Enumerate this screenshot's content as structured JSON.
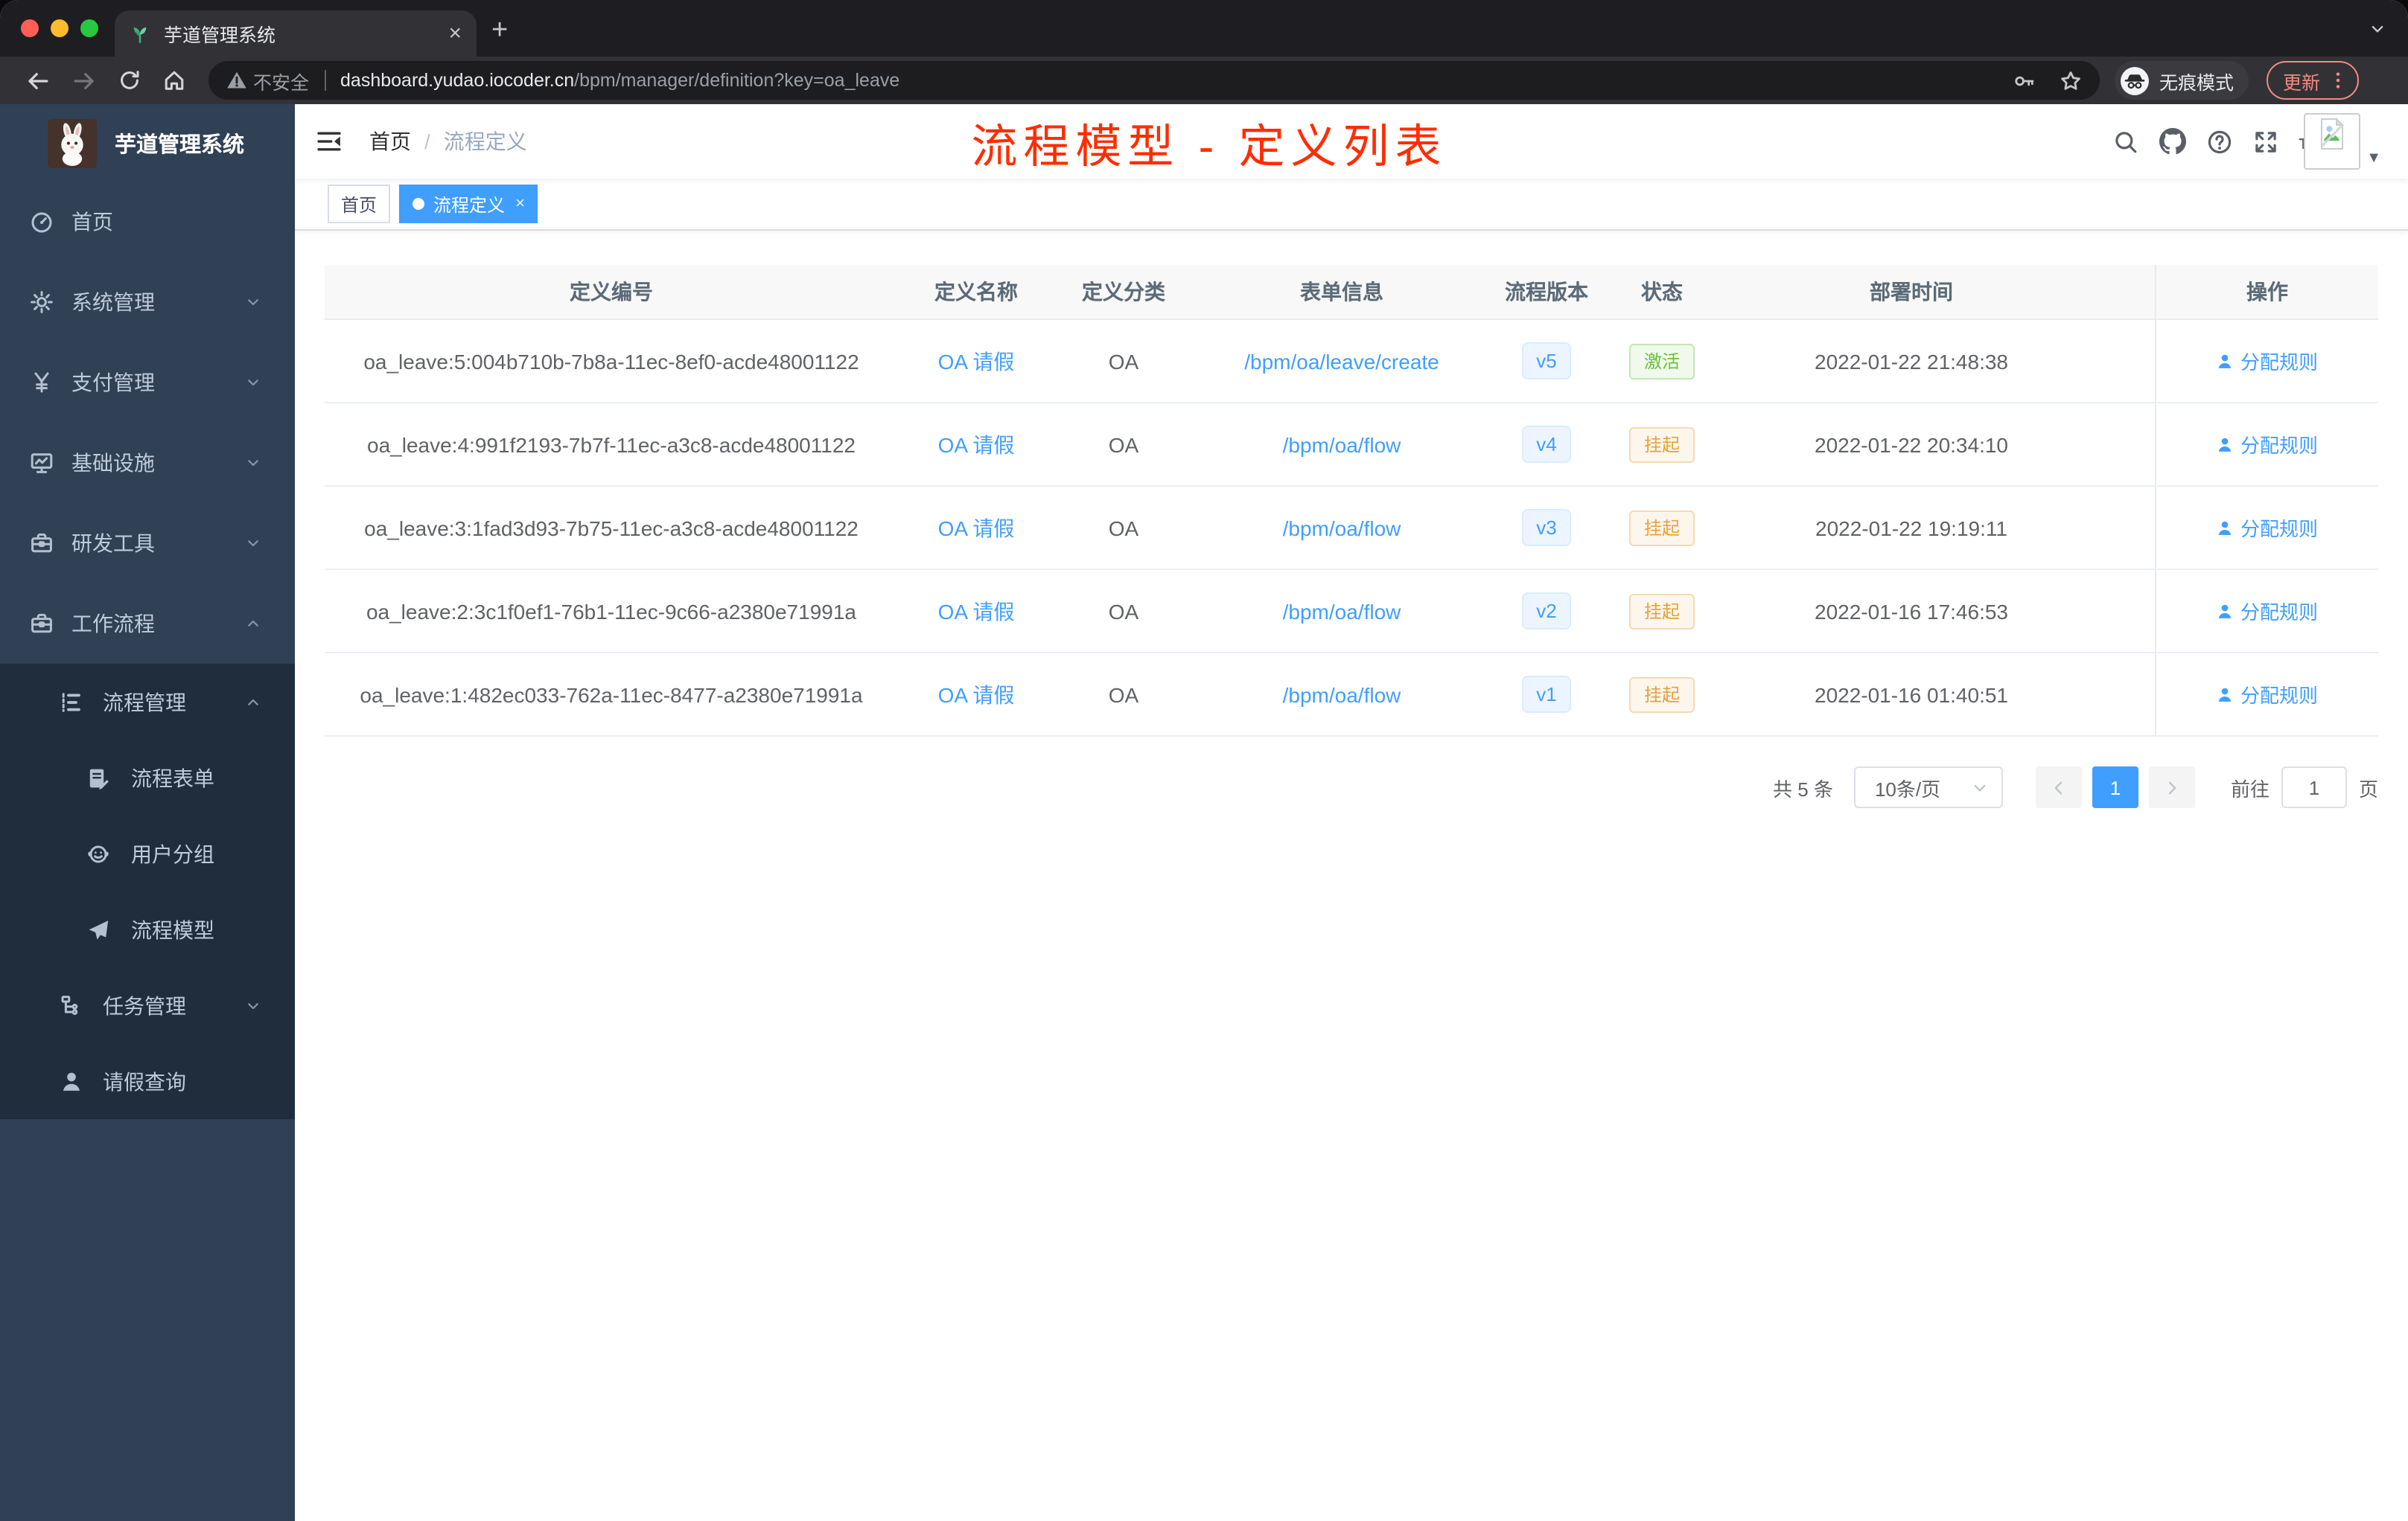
{
  "colors": {
    "accent": "#409eff",
    "success": "#67c23a",
    "warning": "#e6a23c",
    "annotation_red": "#ff2d00",
    "sidebar_bg": "#304156",
    "sidebar_submenu_bg": "#1f2d3d"
  },
  "browser": {
    "tab_title": "芋道管理系统",
    "new_tab_label": "+",
    "tab_close_label": "×",
    "security_label": "不安全",
    "url_host": "dashboard.yudao.iocoder.cn",
    "url_path": "/bpm/manager/definition?key=oa_leave",
    "incognito_label": "无痕模式",
    "update_label": "更新"
  },
  "sidebar": {
    "logo_title": "芋道管理系统",
    "menu": [
      {
        "label": "首页",
        "icon": "dashboard",
        "level": 1,
        "arrow": "",
        "dark": false
      },
      {
        "label": "系统管理",
        "icon": "gear",
        "level": 1,
        "arrow": "down",
        "dark": false
      },
      {
        "label": "支付管理",
        "icon": "yen",
        "level": 1,
        "arrow": "down",
        "dark": false
      },
      {
        "label": "基础设施",
        "icon": "monitor",
        "level": 1,
        "arrow": "down",
        "dark": false
      },
      {
        "label": "研发工具",
        "icon": "toolbox",
        "level": 1,
        "arrow": "down",
        "dark": false
      },
      {
        "label": "工作流程",
        "icon": "briefcase",
        "level": 1,
        "arrow": "up",
        "dark": false
      },
      {
        "label": "流程管理",
        "icon": "tree",
        "level": 2,
        "arrow": "up",
        "dark": true
      },
      {
        "label": "流程表单",
        "icon": "form",
        "level": 3,
        "arrow": "",
        "dark": true
      },
      {
        "label": "用户分组",
        "icon": "people",
        "level": 3,
        "arrow": "",
        "dark": true
      },
      {
        "label": "流程模型",
        "icon": "send",
        "level": 3,
        "arrow": "",
        "dark": true
      },
      {
        "label": "任务管理",
        "icon": "hierarchy",
        "level": 2,
        "arrow": "down",
        "dark": true
      },
      {
        "label": "请假查询",
        "icon": "user",
        "level": 2,
        "arrow": "",
        "dark": true
      }
    ]
  },
  "navbar": {
    "breadcrumb_home": "首页",
    "breadcrumb_sep": "/",
    "breadcrumb_current": "流程定义",
    "annotation": "流程模型 - 定义列表"
  },
  "tags": [
    {
      "label": "首页",
      "active": false,
      "closable": false
    },
    {
      "label": "流程定义",
      "active": true,
      "closable": true,
      "close_label": "×"
    }
  ],
  "table": {
    "columns": [
      "定义编号",
      "定义名称",
      "定义分类",
      "表单信息",
      "流程版本",
      "状态",
      "部署时间",
      "操作"
    ],
    "rows": [
      {
        "id": "oa_leave:5:004b710b-7b8a-11ec-8ef0-acde48001122",
        "name": "OA 请假",
        "category": "OA",
        "form": "/bpm/oa/leave/create",
        "version": "v5",
        "status": "激活",
        "status_type": "active",
        "deploy_time": "2022-01-22 21:48:38",
        "action": "分配规则"
      },
      {
        "id": "oa_leave:4:991f2193-7b7f-11ec-a3c8-acde48001122",
        "name": "OA 请假",
        "category": "OA",
        "form": "/bpm/oa/flow",
        "version": "v4",
        "status": "挂起",
        "status_type": "suspended",
        "deploy_time": "2022-01-22 20:34:10",
        "action": "分配规则"
      },
      {
        "id": "oa_leave:3:1fad3d93-7b75-11ec-a3c8-acde48001122",
        "name": "OA 请假",
        "category": "OA",
        "form": "/bpm/oa/flow",
        "version": "v3",
        "status": "挂起",
        "status_type": "suspended",
        "deploy_time": "2022-01-22 19:19:11",
        "action": "分配规则"
      },
      {
        "id": "oa_leave:2:3c1f0ef1-76b1-11ec-9c66-a2380e71991a",
        "name": "OA 请假",
        "category": "OA",
        "form": "/bpm/oa/flow",
        "version": "v2",
        "status": "挂起",
        "status_type": "suspended",
        "deploy_time": "2022-01-16 17:46:53",
        "action": "分配规则"
      },
      {
        "id": "oa_leave:1:482ec033-762a-11ec-8477-a2380e71991a",
        "name": "OA 请假",
        "category": "OA",
        "form": "/bpm/oa/flow",
        "version": "v1",
        "status": "挂起",
        "status_type": "suspended",
        "deploy_time": "2022-01-16 01:40:51",
        "action": "分配规则"
      }
    ]
  },
  "pagination": {
    "total": "共 5 条",
    "page_size": "10条/页",
    "current_page": "1",
    "goto_label": "前往",
    "goto_value": "1",
    "page_unit": "页"
  }
}
